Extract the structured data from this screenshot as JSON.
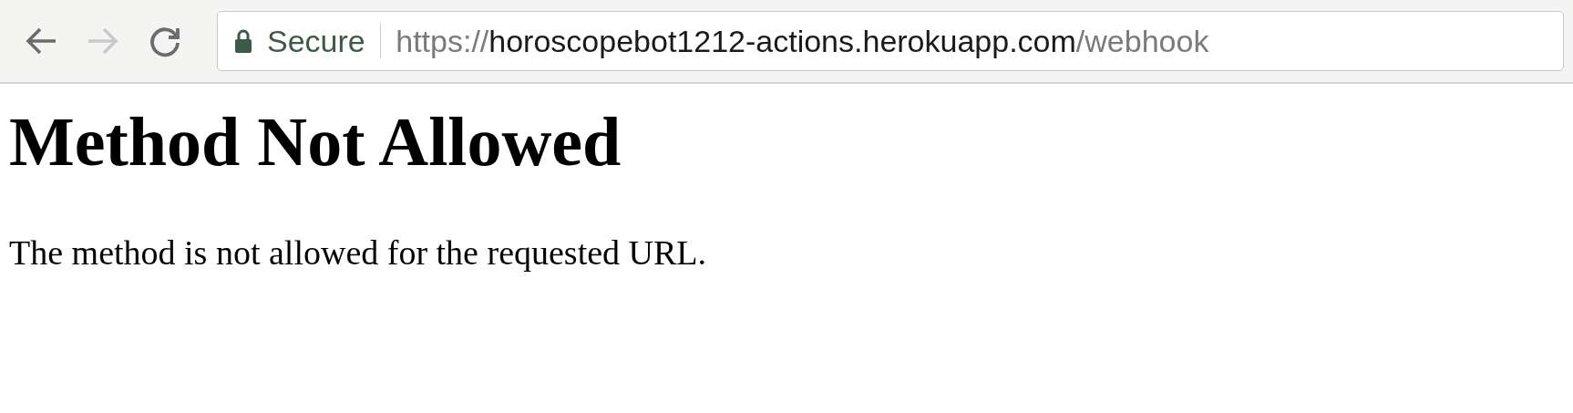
{
  "toolbar": {
    "back": {
      "disabled": false
    },
    "forward": {
      "disabled": true
    }
  },
  "address_bar": {
    "security_label": "Secure",
    "url": {
      "scheme": "https://",
      "host": "horoscopebot1212-actions.herokuapp.com",
      "path": "/webhook"
    }
  },
  "page": {
    "heading": "Method Not Allowed",
    "message": "The method is not allowed for the requested URL."
  }
}
